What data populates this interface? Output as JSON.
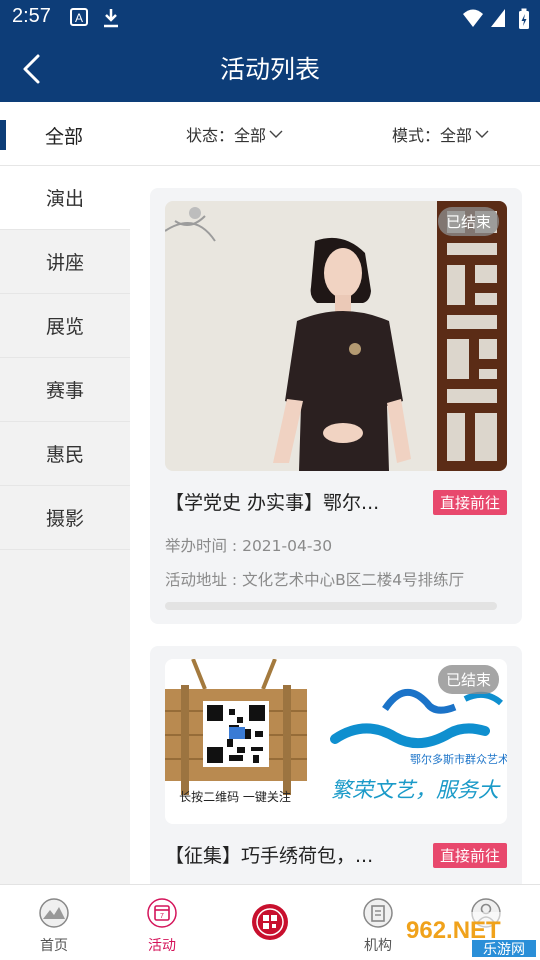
{
  "status_bar": {
    "time": "2:57"
  },
  "header": {
    "title": "活动列表"
  },
  "filters": {
    "all_tab": "全部",
    "status_label": "状态：全部",
    "mode_label": "模式：全部"
  },
  "sidebar": {
    "items": [
      {
        "label": "演出"
      },
      {
        "label": "讲座"
      },
      {
        "label": "展览"
      },
      {
        "label": "赛事"
      },
      {
        "label": "惠民"
      },
      {
        "label": "摄影"
      }
    ]
  },
  "cards": [
    {
      "badge": "已结束",
      "title": "【学党史 办实事】鄂尔...",
      "action": "直接前往",
      "time": "举办时间 : 2021-04-30",
      "address": "活动地址 : 文化艺术中心B区二楼4号排练厅",
      "progress": 0
    },
    {
      "badge": "已结束",
      "title": "【征集】巧手绣荷包，...",
      "action": "直接前往",
      "poster_caption": "长按二维码  一键关注",
      "poster_org": "鄂尔多斯市群众艺术馆",
      "poster_slogan": "繁荣文艺，服务大"
    }
  ],
  "tabbar": {
    "items": [
      {
        "label": "首页"
      },
      {
        "label": "活动"
      },
      {
        "label": ""
      },
      {
        "label": "机构"
      },
      {
        "label": ""
      }
    ],
    "active_color": "#d4145a"
  },
  "watermark": {
    "main": "962.NET",
    "sub": "乐游网"
  },
  "colors": {
    "primary": "#0d3d78",
    "accent": "#e8486d"
  }
}
